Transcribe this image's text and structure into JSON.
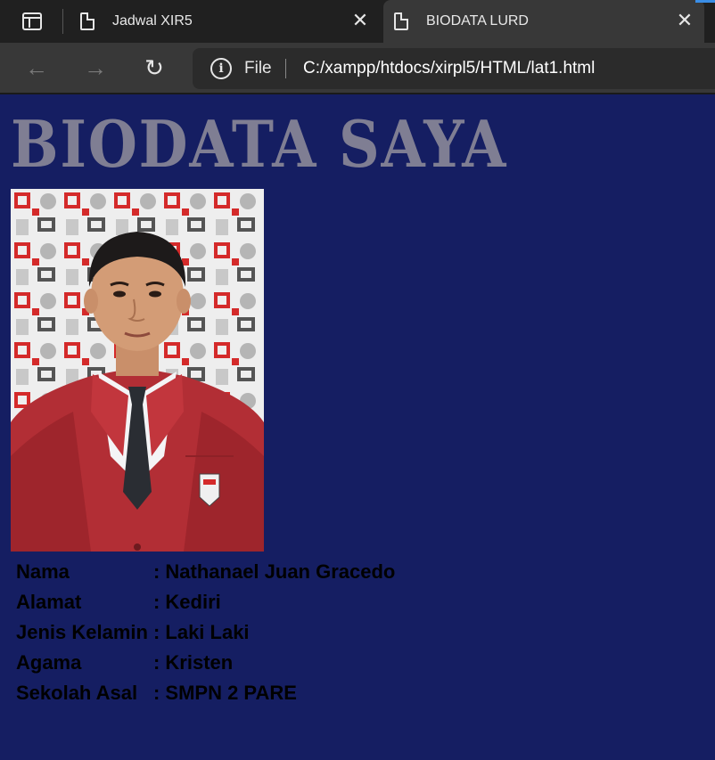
{
  "browser": {
    "tabs": [
      {
        "title": "Jadwal XIR5",
        "active": false
      },
      {
        "title": "BIODATA LURD",
        "active": true
      }
    ],
    "address": {
      "scheme_label": "File",
      "url": "C:/xampp/htdocs/xirpl5/HTML/lat1.html"
    }
  },
  "page": {
    "heading": "BIODATA SAYA",
    "background_color": "#151e62",
    "biodata": [
      {
        "label": "Nama",
        "value": ": Nathanael Juan Gracedo"
      },
      {
        "label": "Alamat",
        "value": ": Kediri"
      },
      {
        "label": "Jenis Kelamin",
        "value": ": Laki Laki"
      },
      {
        "label": "Agama",
        "value": ": Kristen"
      },
      {
        "label": "Sekolah Asal",
        "value": ": SMPN 2 PARE"
      }
    ]
  },
  "icons": [
    "tab-actions-icon",
    "page-icon",
    "close-icon",
    "back-arrow-icon",
    "forward-arrow-icon",
    "reload-icon",
    "info-icon"
  ]
}
